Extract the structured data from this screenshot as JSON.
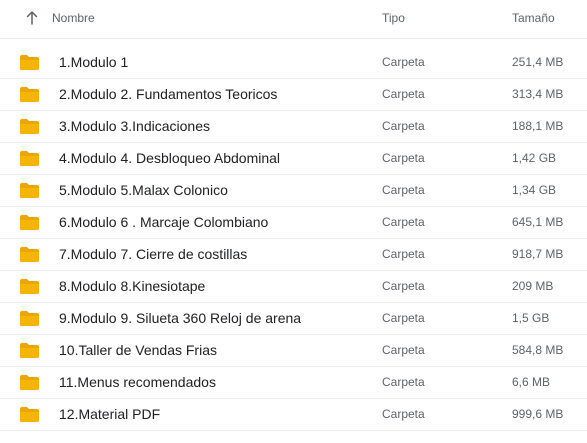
{
  "header": {
    "sort_icon": "arrow-up-icon",
    "name_label": "Nombre",
    "type_label": "Tipo",
    "size_label": "Tamaño"
  },
  "colors": {
    "folder": "#F4B400",
    "folder_tab": "#E8A600",
    "text_primary": "#202124",
    "text_secondary": "#5F6368",
    "divider": "#EDEDED"
  },
  "rows": [
    {
      "name": "1.Modulo 1",
      "type": "Carpeta",
      "size": "251,4 MB",
      "icon": "folder-icon"
    },
    {
      "name": "2.Modulo 2. Fundamentos Teoricos",
      "type": "Carpeta",
      "size": "313,4 MB",
      "icon": "folder-icon"
    },
    {
      "name": "3.Modulo 3.Indicaciones",
      "type": "Carpeta",
      "size": "188,1 MB",
      "icon": "folder-icon"
    },
    {
      "name": "4.Modulo 4. Desbloqueo Abdominal",
      "type": "Carpeta",
      "size": "1,42 GB",
      "icon": "folder-icon"
    },
    {
      "name": "5.Modulo 5.Malax Colonico",
      "type": "Carpeta",
      "size": "1,34 GB",
      "icon": "folder-icon"
    },
    {
      "name": "6.Modulo 6 . Marcaje Colombiano",
      "type": "Carpeta",
      "size": "645,1 MB",
      "icon": "folder-icon"
    },
    {
      "name": "7.Modulo 7. Cierre de costillas",
      "type": "Carpeta",
      "size": "918,7 MB",
      "icon": "folder-icon"
    },
    {
      "name": "8.Modulo 8.Kinesiotape",
      "type": "Carpeta",
      "size": "209 MB",
      "icon": "folder-icon"
    },
    {
      "name": "9.Modulo 9. Silueta 360 Reloj de arena",
      "type": "Carpeta",
      "size": "1,5 GB",
      "icon": "folder-icon"
    },
    {
      "name": "10.Taller de Vendas Frias",
      "type": "Carpeta",
      "size": "584,8 MB",
      "icon": "folder-icon"
    },
    {
      "name": "11.Menus recomendados",
      "type": "Carpeta",
      "size": "6,6 MB",
      "icon": "folder-icon"
    },
    {
      "name": "12.Material PDF",
      "type": "Carpeta",
      "size": "999,6 MB",
      "icon": "folder-icon"
    }
  ]
}
